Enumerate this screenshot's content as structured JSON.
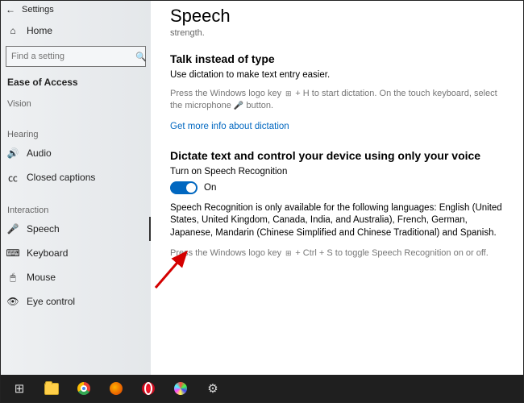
{
  "titlebar": {
    "app": "Settings"
  },
  "sidebar": {
    "home": "Home",
    "search_placeholder": "Find a setting",
    "category": "Ease of Access",
    "groups": {
      "vision": "Vision",
      "hearing": "Hearing",
      "interaction": "Interaction"
    },
    "items": {
      "audio": "Audio",
      "closed_captions": "Closed captions",
      "speech": "Speech",
      "keyboard": "Keyboard",
      "mouse": "Mouse",
      "eye_control": "Eye control"
    }
  },
  "page": {
    "title": "Speech",
    "subtitle": "strength.",
    "talk": {
      "heading": "Talk instead of type",
      "body": "Use dictation to make text entry easier.",
      "hint_pre": "Press the Windows logo key ",
      "hint_mid": " + H to start dictation.  On the touch keyboard, select the microphone ",
      "hint_post": " button.",
      "link": "Get more info about dictation"
    },
    "dictate": {
      "heading": "Dictate text and control your device using only your voice",
      "toggle_label": "Turn on Speech Recognition",
      "toggle_state": "On",
      "availability": "Speech Recognition is only available for the following languages: English (United States, United Kingdom, Canada, India, and Australia), French, German, Japanese, Mandarin (Chinese Simplified and Chinese Traditional) and Spanish.",
      "hint_pre": "Press the Windows logo key ",
      "hint_post": " + Ctrl + S to toggle Speech Recognition on or off."
    }
  },
  "taskbar": {
    "items": [
      "start",
      "explorer",
      "chrome",
      "firefox",
      "opera",
      "paint",
      "settings"
    ]
  }
}
